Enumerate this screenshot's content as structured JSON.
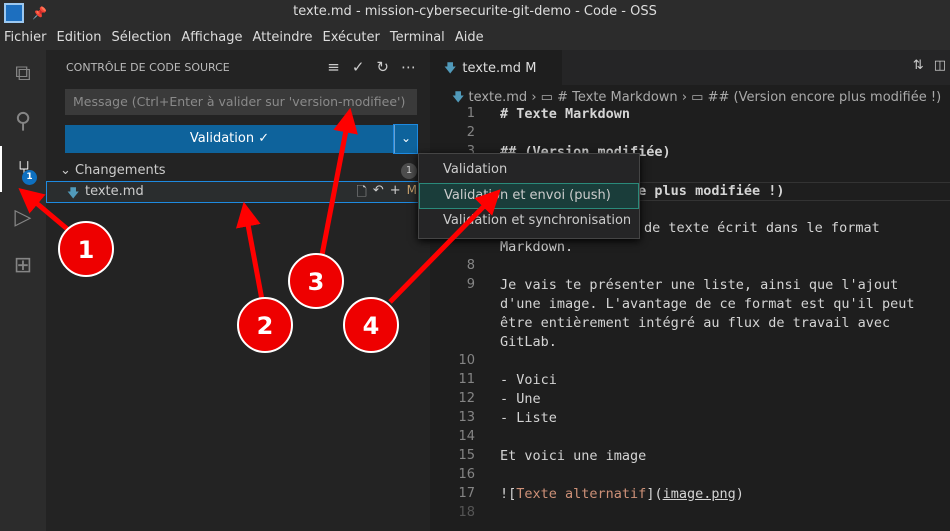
{
  "window": {
    "title": "texte.md - mission-cybersecurite-git-demo - Code - OSS"
  },
  "menubar": [
    "Fichier",
    "Edition",
    "Sélection",
    "Affichage",
    "Atteindre",
    "Exécuter",
    "Terminal",
    "Aide"
  ],
  "activity": {
    "scm_badge": "1"
  },
  "scm": {
    "header": "CONTRÔLE DE CODE SOURCE",
    "message_placeholder": "Message (Ctrl+Enter à valider sur 'version-modifiee')",
    "commit_label": "Validation ✓",
    "changes_label": "Changements",
    "changes_count": "1",
    "file": {
      "name": "texte.md",
      "status": "M"
    }
  },
  "commit_menu": [
    "Validation",
    "Validation et envoi (push)",
    "Validation et synchronisation"
  ],
  "editor": {
    "tab": {
      "name": "texte.md",
      "status": "M"
    },
    "breadcrumb": [
      "texte.md",
      "# Texte Markdown",
      "## (Version encore plus modifiée !)"
    ],
    "lines": {
      "l1": "# Texte Markdown",
      "l3": "## (Version modifiée)",
      "l5": "## (Version encore plus modifiée !)",
      "l7": "de texte écrit dans le format",
      "l7b": "Markdown.",
      "l9a": "Je vais te présenter une liste, ainsi que l'ajout",
      "l9b": "d'une image. L'avantage de ce format est qu'il peut",
      "l9c": "être entièrement intégré au flux de travail avec",
      "l9d": "GitLab.",
      "l11": "- Voici",
      "l12": "- Une",
      "l13": "- Liste",
      "l15": "Et voici une image",
      "l17a": "![",
      "l17b": "Texte alternatif",
      "l17c": "](",
      "l17d": "image.png",
      "l17e": ")"
    }
  },
  "annotations": [
    "1",
    "2",
    "3",
    "4"
  ],
  "colors": {
    "accent": "#0e639c",
    "annotation": "#e00000"
  }
}
